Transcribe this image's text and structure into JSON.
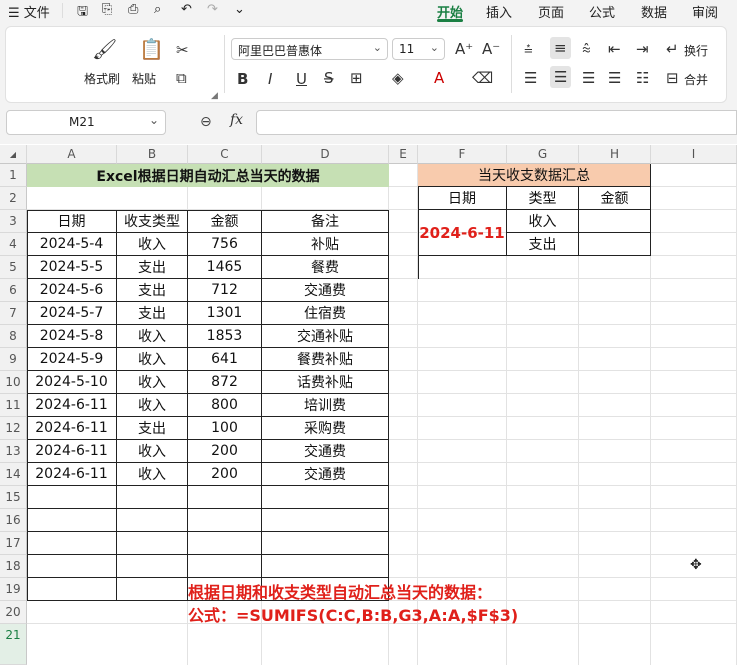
{
  "menu": {
    "file": "文件",
    "tabs": [
      "开始",
      "插入",
      "页面",
      "公式",
      "数据",
      "审阅"
    ]
  },
  "ribbon": {
    "format_painter": "格式刷",
    "paste": "粘贴",
    "font_name": "阿里巴巴普惠体",
    "font_size": "11",
    "bold": "B",
    "italic": "I",
    "underline": "U",
    "wrap": "换行",
    "merge": "合并"
  },
  "formula_bar": {
    "name_box": "M21",
    "fx": "fx",
    "formula": ""
  },
  "columns": [
    "A",
    "B",
    "C",
    "D",
    "E",
    "F",
    "G",
    "H",
    "I"
  ],
  "rows": [
    "1",
    "2",
    "3",
    "4",
    "5",
    "6",
    "7",
    "8",
    "9",
    "10",
    "11",
    "12",
    "13",
    "14",
    "15",
    "16",
    "17",
    "18",
    "19",
    "20",
    "21"
  ],
  "left_table": {
    "title": "Excel根据日期自动汇总当天的数据",
    "headers": [
      "日期",
      "收支类型",
      "金额",
      "备注"
    ],
    "rows": [
      [
        "2024-5-4",
        "收入",
        "756",
        "补贴"
      ],
      [
        "2024-5-5",
        "支出",
        "1465",
        "餐费"
      ],
      [
        "2024-5-6",
        "支出",
        "712",
        "交通费"
      ],
      [
        "2024-5-7",
        "支出",
        "1301",
        "住宿费"
      ],
      [
        "2024-5-8",
        "收入",
        "1853",
        "交通补贴"
      ],
      [
        "2024-5-9",
        "收入",
        "641",
        "餐费补贴"
      ],
      [
        "2024-5-10",
        "收入",
        "872",
        "话费补贴"
      ],
      [
        "2024-6-11",
        "收入",
        "800",
        "培训费"
      ],
      [
        "2024-6-11",
        "支出",
        "100",
        "采购费"
      ],
      [
        "2024-6-11",
        "收入",
        "200",
        "交通费"
      ],
      [
        "2024-6-11",
        "收入",
        "200",
        "交通费"
      ]
    ]
  },
  "right_table": {
    "title": "当天收支数据汇总",
    "headers": [
      "日期",
      "类型",
      "金额"
    ],
    "date": "2024-6-11",
    "types": [
      "收入",
      "支出"
    ]
  },
  "notes": {
    "line1": "根据日期和收支类型自动汇总当天的数据：",
    "line2": "公式：=SUMIFS(C:C,B:B,G3,A:A,$F$3)"
  },
  "colors": {
    "accent": "#1a7f43",
    "title_fill": "#c6e0b4",
    "summary_fill": "#f8cbad",
    "note_red": "#e0201a"
  }
}
